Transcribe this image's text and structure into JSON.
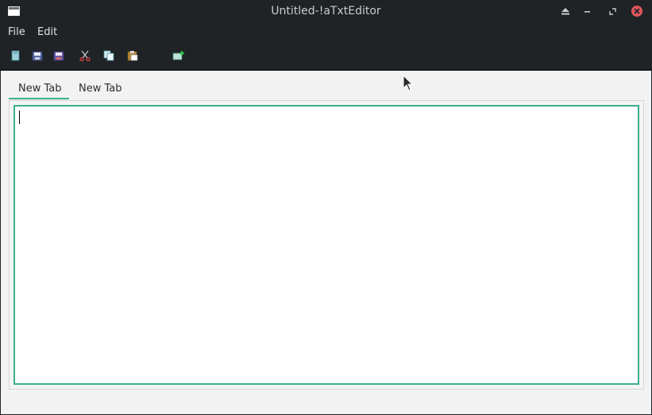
{
  "window": {
    "title": "Untitled-!aTxtEditor",
    "icon": "window-icon",
    "controls": [
      "eject-icon",
      "minimize-icon",
      "restore-icon",
      "close-icon"
    ]
  },
  "menu": {
    "file": "File",
    "edit": "Edit"
  },
  "toolbar": {
    "items": [
      "new-file-icon",
      "save-icon",
      "save-as-icon",
      "cut-icon",
      "copy-icon",
      "paste-icon",
      "add-tab-icon"
    ]
  },
  "tabs": [
    {
      "label": "New Tab",
      "active": true
    },
    {
      "label": "New Tab",
      "active": false
    }
  ],
  "editor": {
    "text": ""
  },
  "colors": {
    "titlebar": "#1f2326",
    "accent": "#3daf90",
    "close": "#e0555c",
    "content_bg": "#f2f2f2"
  }
}
